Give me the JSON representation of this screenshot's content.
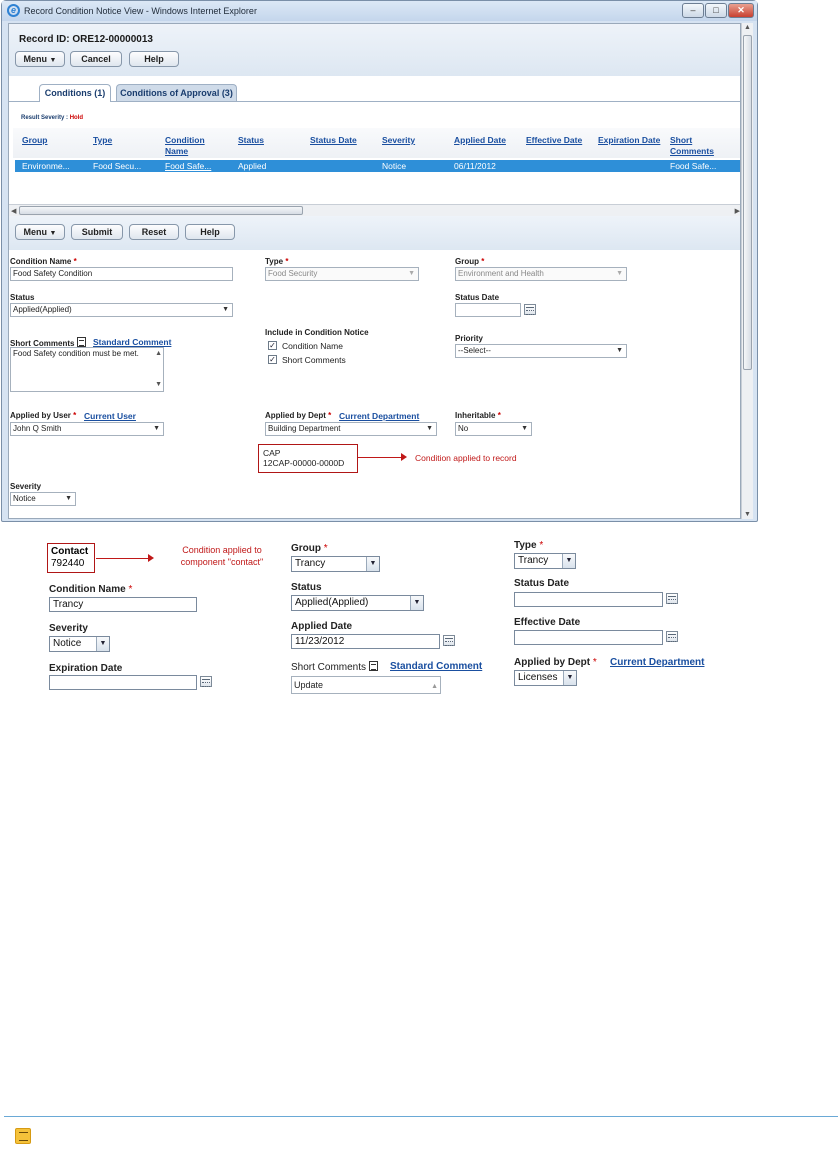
{
  "window": {
    "title": "Record Condition Notice View - Windows Internet Explorer",
    "controls": [
      "–",
      "□",
      "✕"
    ]
  },
  "header": {
    "record_id": "Record ID: ORE12-00000013",
    "buttons": {
      "menu": "Menu",
      "cancel": "Cancel",
      "help": "Help"
    }
  },
  "tabs": [
    {
      "label": "Conditions (1)",
      "active": true
    },
    {
      "label": "Conditions of Approval (3)",
      "active": false
    }
  ],
  "result_severity": {
    "label": "Result Severity :",
    "value": "Hold"
  },
  "grid": {
    "columns": [
      "Group",
      "Type",
      "Condition Name",
      "Status",
      "Status Date",
      "Severity",
      "Applied Date",
      "Effective Date",
      "Expiration Date",
      "Short Comments"
    ],
    "rows": [
      {
        "group": "Environme...",
        "type": "Food Secu...",
        "condition_name": "Food Safe...",
        "status": "Applied",
        "status_date": "",
        "severity": "Notice",
        "applied_date": "06/11/2012",
        "effective_date": "",
        "expiration_date": "",
        "short_comments": "Food Safe..."
      }
    ]
  },
  "form_toolbar": {
    "menu": "Menu",
    "submit": "Submit",
    "reset": "Reset",
    "help": "Help"
  },
  "form": {
    "condition_name": {
      "label": "Condition Name",
      "value": "Food Safety Condition"
    },
    "type": {
      "label": "Type",
      "value": "Food Security"
    },
    "group": {
      "label": "Group",
      "value": "Environment and Health"
    },
    "status": {
      "label": "Status",
      "value": "Applied(Applied)"
    },
    "status_date": {
      "label": "Status Date",
      "value": ""
    },
    "short_comments": {
      "label": "Short Comments",
      "link": "Standard Comment",
      "value": "Food Safety condition must be met."
    },
    "include_notice": {
      "label": "Include in Condition Notice",
      "options": [
        "Condition Name",
        "Short Comments"
      ],
      "checked": [
        true,
        true
      ]
    },
    "priority": {
      "label": "Priority",
      "value": "--Select--"
    },
    "applied_by_user": {
      "label": "Applied by User",
      "link": "Current User",
      "value": "John Q Smith"
    },
    "applied_by_dept": {
      "label": "Applied by Dept",
      "link": "Current Department",
      "value": "Building Department"
    },
    "inheritable": {
      "label": "Inheritable",
      "value": "No"
    },
    "cap_box": {
      "line1": "CAP",
      "line2": "12CAP-00000-0000D"
    },
    "cap_annotation": "Condition applied to record",
    "severity": {
      "label": "Severity",
      "value": "Notice"
    }
  },
  "lower": {
    "contact_box": {
      "line1": "Contact",
      "line2": "792440"
    },
    "contact_annotation": [
      "Condition applied to",
      "component \"contact\""
    ],
    "group": {
      "label": "Group",
      "value": "Trancy"
    },
    "type": {
      "label": "Type",
      "value": "Trancy"
    },
    "condition_name": {
      "label": "Condition Name",
      "value": "Trancy"
    },
    "status": {
      "label": "Status",
      "value": "Applied(Applied)"
    },
    "status_date": {
      "label": "Status Date",
      "value": ""
    },
    "severity": {
      "label": "Severity",
      "value": "Notice"
    },
    "applied_date": {
      "label": "Applied Date",
      "value": "11/23/2012"
    },
    "effective_date": {
      "label": "Effective Date",
      "value": ""
    },
    "expiration_date": {
      "label": "Expiration Date",
      "value": ""
    },
    "short_comments": {
      "label": "Short Comments",
      "link": "Standard Comment",
      "value": "Update"
    },
    "applied_by_dept": {
      "label": "Applied by Dept",
      "link": "Current Department",
      "value": "Licenses"
    }
  },
  "required_mark": "*",
  "dropdown_glyph": "▼",
  "colors": {
    "accent_link": "#1a4fa0",
    "required": "#cc0000",
    "selected_row": "#2e8fd8",
    "annotation_red": "#c01818"
  }
}
